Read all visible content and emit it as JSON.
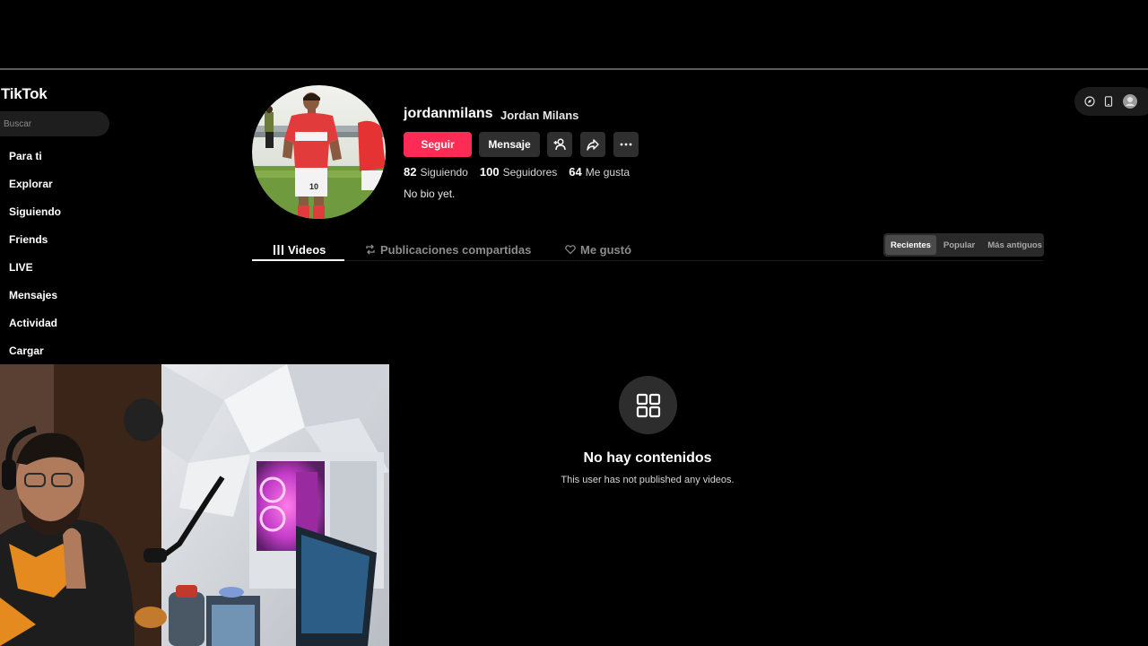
{
  "app": {
    "logo": "TikTok"
  },
  "search": {
    "placeholder": "Buscar"
  },
  "sidebar": {
    "items": [
      {
        "label": "Para ti"
      },
      {
        "label": "Explorar"
      },
      {
        "label": "Siguiendo"
      },
      {
        "label": "Friends"
      },
      {
        "label": "LIVE"
      },
      {
        "label": "Mensajes"
      },
      {
        "label": "Actividad"
      },
      {
        "label": "Cargar"
      }
    ]
  },
  "profile": {
    "username": "jordanmilans",
    "display_name": "Jordan Milans",
    "follow_label": "Seguir",
    "message_label": "Mensaje",
    "stats": {
      "following": {
        "value": "82",
        "label": "Siguiendo"
      },
      "followers": {
        "value": "100",
        "label": "Seguidores"
      },
      "likes": {
        "value": "64",
        "label": "Me gusta"
      }
    },
    "bio": "No bio yet.",
    "jersey_number": "10"
  },
  "tabs": [
    {
      "label": "Videos"
    },
    {
      "label": "Publicaciones compartidas"
    },
    {
      "label": "Me gustó"
    }
  ],
  "sort": {
    "options": [
      {
        "label": "Recientes"
      },
      {
        "label": "Popular"
      },
      {
        "label": "Más antiguos"
      }
    ]
  },
  "empty_state": {
    "title": "No hay contenidos",
    "subtitle": "This user has not published any videos."
  },
  "colors": {
    "accent": "#fe2c55",
    "background": "#000000",
    "button_secondary": "#2f2f2f"
  }
}
